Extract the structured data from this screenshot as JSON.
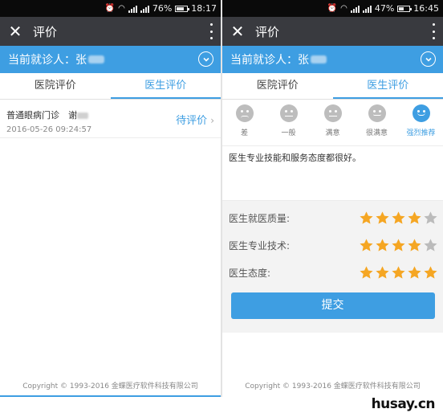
{
  "left": {
    "status": {
      "battery": "76%",
      "time": "18:17",
      "battery_level": 0.76
    },
    "title": "评价",
    "patient_prefix": "当前就诊人：张",
    "tabs": [
      "医院评价",
      "医生评价"
    ],
    "record": {
      "dept": "普通眼病门诊",
      "doctor": "谢",
      "time": "2016-05-26 09:24:57",
      "action": "待评价"
    },
    "copyright": "Copyright © 1993-2016 金蝶医疗软件科技有限公司"
  },
  "right": {
    "status": {
      "battery": "47%",
      "time": "16:45",
      "battery_level": 0.47
    },
    "title": "评价",
    "patient_prefix": "当前就诊人：张",
    "tabs": [
      "医院评价",
      "医生评价"
    ],
    "faces": [
      "差",
      "一般",
      "满意",
      "很满意",
      "强烈推荐"
    ],
    "selected_face": 4,
    "comment": "医生专业技能和服务态度都很好。",
    "criteria": [
      {
        "label": "医生就医质量:",
        "stars": 4
      },
      {
        "label": "医生专业技术:",
        "stars": 4
      },
      {
        "label": "医生态度:",
        "stars": 5
      }
    ],
    "submit": "提交",
    "copyright": "Copyright © 1993-2016 金蝶医疗软件科技有限公司"
  },
  "colors": {
    "accent": "#3e9ee2",
    "star_on": "#f5a623",
    "star_off": "#bbbbbb"
  },
  "watermark": "husay.cn"
}
